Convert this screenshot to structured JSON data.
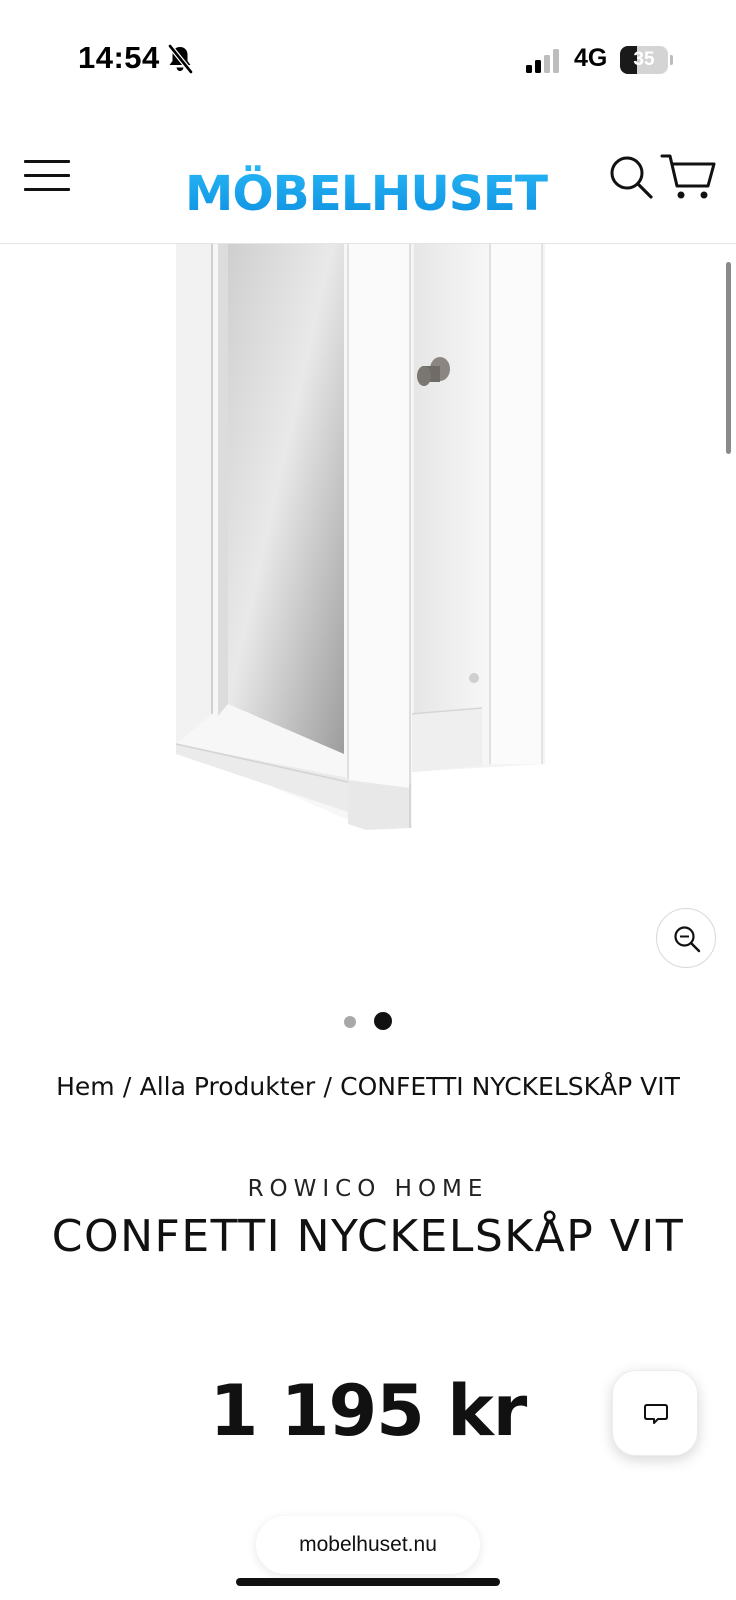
{
  "status_bar": {
    "time": "14:54",
    "network": "4G",
    "battery_level": "35",
    "battery_fraction": 0.35,
    "silent_icon": "bell-slash-icon",
    "signal_icon": "cellular-signal-icon"
  },
  "header": {
    "logo_text": "MÖBELHUSET",
    "logo_color": "#1aa3e8",
    "menu_icon": "hamburger-menu-icon",
    "search_icon": "search-icon",
    "cart_icon": "cart-icon"
  },
  "gallery": {
    "image": "key-cabinet-mirror-open-door-image",
    "zoom_icon": "zoom-icon",
    "slides_total": 2,
    "active_slide": 2
  },
  "breadcrumb": {
    "home": "Hem",
    "separator": "/",
    "all_products": "Alla Produkter",
    "current": "CONFETTI NYCKELSKÅP VIT"
  },
  "product": {
    "vendor": "ROWICO HOME",
    "title": "CONFETTI NYCKELSKÅP VIT",
    "price": "1 195 kr"
  },
  "chat": {
    "icon": "chat-bubble-icon"
  },
  "browser": {
    "url": "mobelhuset.nu"
  }
}
